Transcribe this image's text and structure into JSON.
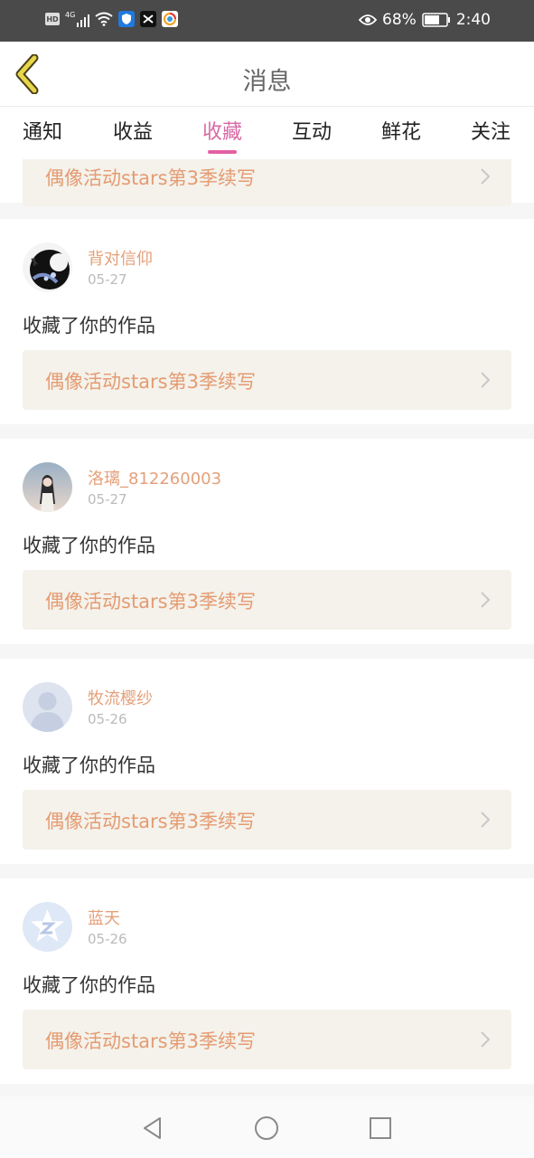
{
  "status_bar": {
    "left_icons": [
      "hd-icon",
      "4g-signal-icon",
      "wifi-icon",
      "shield-app-icon",
      "capcut-app-icon",
      "browser-app-icon"
    ],
    "network_label": "4G",
    "hd_label": "HD",
    "battery_percent": "68%",
    "time": "2:40"
  },
  "header": {
    "title": "消息"
  },
  "tabs": [
    {
      "label": "通知",
      "active": false
    },
    {
      "label": "收益",
      "active": false
    },
    {
      "label": "收藏",
      "active": true
    },
    {
      "label": "互动",
      "active": false
    },
    {
      "label": "鲜花",
      "active": false
    },
    {
      "label": "关注",
      "active": false
    }
  ],
  "partial_card": {
    "work_title": "偶像活动stars第3季续写"
  },
  "items": [
    {
      "user": "背对信仰",
      "date": "05-27",
      "action": "收藏了你的作品",
      "work_title": "偶像活动stars第3季续写",
      "avatar": "ink-painting"
    },
    {
      "user": "洛璃_812260003",
      "date": "05-27",
      "action": "收藏了你的作品",
      "work_title": "偶像活动stars第3季续写",
      "avatar": "girl-photo"
    },
    {
      "user": "牧流樱纱",
      "date": "05-26",
      "action": "收藏了你的作品",
      "work_title": "偶像活动stars第3季续写",
      "avatar": "default-person"
    },
    {
      "user": "蓝天",
      "date": "05-26",
      "action": "收藏了你的作品",
      "work_title": "偶像活动stars第3季续写",
      "avatar": "qzone-star"
    }
  ],
  "colors": {
    "accent_pink": "#e35fa2",
    "username_orange": "#e4a07a",
    "work_title_orange": "#e59b72",
    "work_link_bg": "#f4f2eb"
  }
}
